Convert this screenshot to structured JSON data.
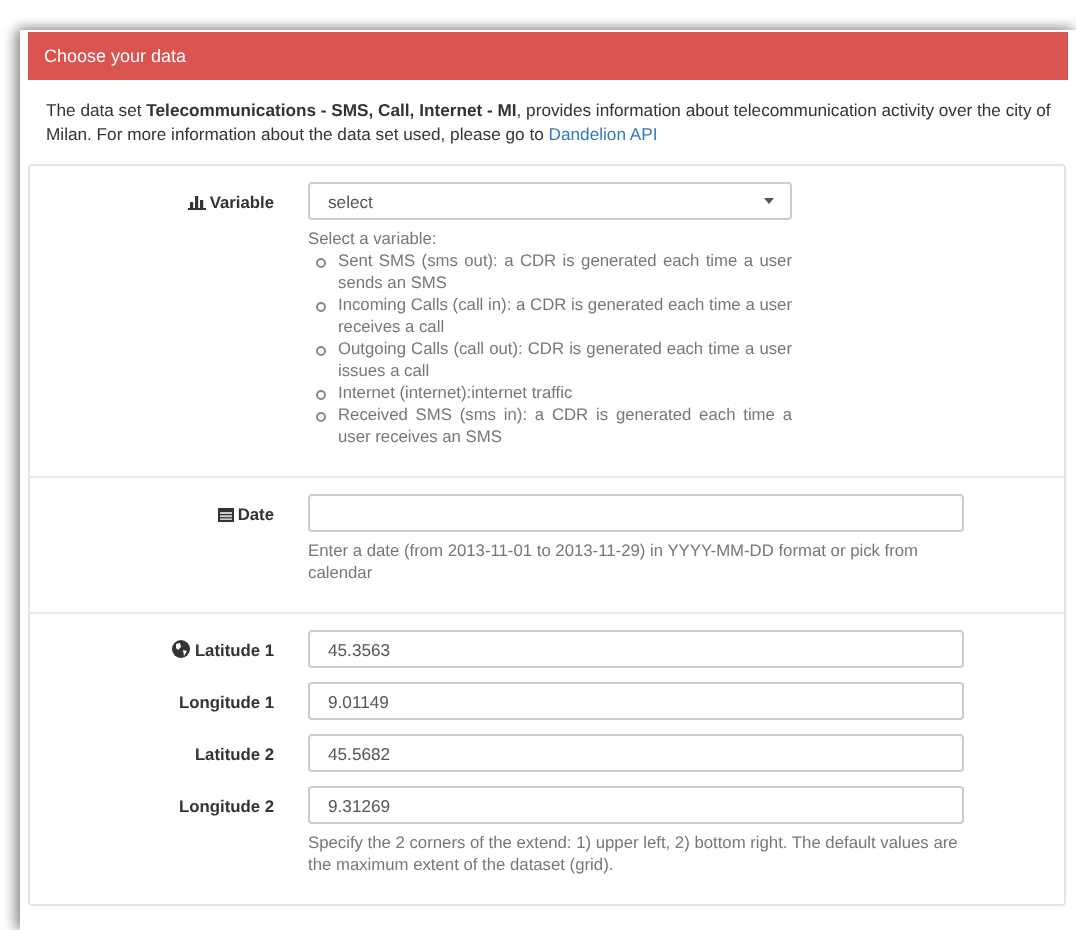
{
  "panel": {
    "title": "Choose your data"
  },
  "intro": {
    "text": "The data set **Telecommunications - SMS, Call, Internet - MI**, provides information about telecommunication activity over the city of Milan. For more information about the data set used, please go to ",
    "link": "Dandelion API"
  },
  "sections": [
    {
      "fields": [
        {
          "kind": "select",
          "label": "Variable",
          "value": "select"
        }
      ],
      "help": "Select a variable:",
      "help_items": [
        "Sent SMS (sms out): a CDR is generated each time a user sends an SMS",
        "Incoming Calls (call in): a CDR is generated each time a user receives a call",
        "Outgoing Calls (call out): CDR is generated each time a user issues a call",
        "Internet (internet):internet traffic",
        "Received SMS (sms in): a CDR is generated each time a user receives an SMS"
      ]
    },
    {
      "fields": [
        {
          "kind": "text",
          "label": "Date"
        }
      ],
      "help": "Enter a date (from 2013-11-01 to 2013-11-29) in YYYY-MM-DD format or pick from calendar"
    },
    {
      "fields": [
        {
          "kind": "text",
          "label": "Latitude 1",
          "value": "45.3563"
        },
        {
          "kind": "text",
          "label": "Longitude 1",
          "value": "9.01149"
        },
        {
          "kind": "text",
          "label": "Latitude 2",
          "value": "45.5682"
        },
        {
          "kind": "text",
          "label": "Longitude 2",
          "value": "9.31269"
        }
      ],
      "help": "Specify the 2 corners of the extend: 1) upper left, 2) bottom right. The default values are the maximum extent of the dataset (grid)."
    }
  ]
}
